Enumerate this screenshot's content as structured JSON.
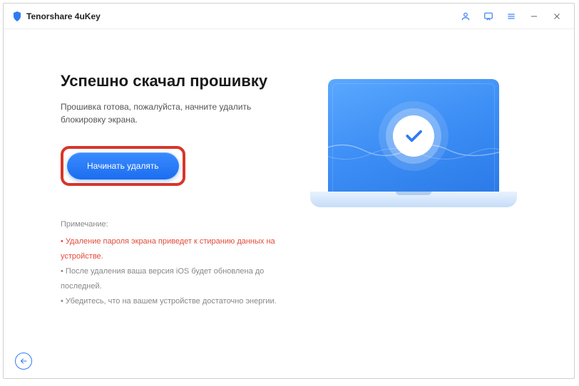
{
  "app": {
    "title": "Tenorshare 4uKey"
  },
  "main": {
    "heading": "Успешно скачал прошивку",
    "subtext": "Прошивка готова, пожалуйста, начните удалить блокировку экрана.",
    "cta_label": "Начинать удалять"
  },
  "notes": {
    "title": "Примечание:",
    "items": [
      {
        "text": "Удаление пароля экрана приведет к стиранию данных на устройстве.",
        "warn": true
      },
      {
        "text": "После удаления ваша версия iOS будет обновлена до последней.",
        "warn": false
      },
      {
        "text": "Убедитесь, что на вашем устройстве достаточно энергии.",
        "warn": false
      }
    ]
  },
  "colors": {
    "accent": "#2f7bf5",
    "highlight": "#d8362a"
  }
}
